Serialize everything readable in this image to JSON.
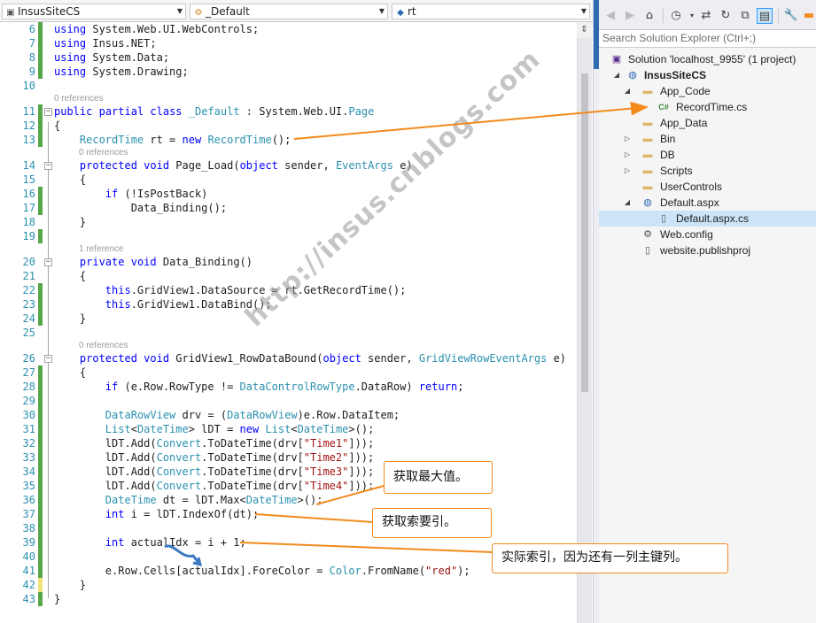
{
  "navbar": {
    "project_combo": "InsusSiteCS",
    "class_combo": "_Default",
    "member_combo": "rt"
  },
  "editor": {
    "lines": [
      {
        "n": "6",
        "seg": [
          [
            "k",
            "using"
          ],
          [
            "p",
            " System.Web.UI.WebControls;"
          ]
        ]
      },
      {
        "n": "7",
        "seg": [
          [
            "k",
            "using"
          ],
          [
            "p",
            " Insus.NET;"
          ]
        ]
      },
      {
        "n": "8",
        "seg": [
          [
            "k",
            "using"
          ],
          [
            "p",
            " System.Data;"
          ]
        ]
      },
      {
        "n": "9",
        "seg": [
          [
            "k",
            "using"
          ],
          [
            "p",
            " System.Drawing;"
          ]
        ]
      },
      {
        "n": "10",
        "seg": []
      },
      {
        "n": "11",
        "seg": [
          [
            "k",
            "public"
          ],
          [
            "p",
            " "
          ],
          [
            "k",
            "partial"
          ],
          [
            "p",
            " "
          ],
          [
            "k",
            "class"
          ],
          [
            "p",
            " "
          ],
          [
            "t",
            "_Default"
          ],
          [
            "p",
            " : System.Web.UI."
          ],
          [
            "t",
            "Page"
          ]
        ]
      },
      {
        "n": "12",
        "seg": [
          [
            "p",
            "{"
          ]
        ]
      },
      {
        "n": "13",
        "seg": [
          [
            "p",
            "    "
          ],
          [
            "t",
            "RecordTime"
          ],
          [
            "p",
            " rt = "
          ],
          [
            "k",
            "new"
          ],
          [
            "p",
            " "
          ],
          [
            "t",
            "RecordTime"
          ],
          [
            "p",
            "();"
          ]
        ]
      },
      {
        "n": "14",
        "seg": [
          [
            "p",
            "    "
          ],
          [
            "k",
            "protected"
          ],
          [
            "p",
            " "
          ],
          [
            "k",
            "void"
          ],
          [
            "p",
            " Page_Load("
          ],
          [
            "k",
            "object"
          ],
          [
            "p",
            " sender, "
          ],
          [
            "t",
            "EventArgs"
          ],
          [
            "p",
            " e)"
          ]
        ]
      },
      {
        "n": "15",
        "seg": [
          [
            "p",
            "    {"
          ]
        ]
      },
      {
        "n": "16",
        "seg": [
          [
            "p",
            "        "
          ],
          [
            "k",
            "if"
          ],
          [
            "p",
            " (!IsPostBack)"
          ]
        ]
      },
      {
        "n": "17",
        "seg": [
          [
            "p",
            "            Data_Binding();"
          ]
        ]
      },
      {
        "n": "18",
        "seg": [
          [
            "p",
            "    }"
          ]
        ]
      },
      {
        "n": "19",
        "seg": []
      },
      {
        "n": "20",
        "seg": [
          [
            "p",
            "    "
          ],
          [
            "k",
            "private"
          ],
          [
            "p",
            " "
          ],
          [
            "k",
            "void"
          ],
          [
            "p",
            " Data_Binding()"
          ]
        ]
      },
      {
        "n": "21",
        "seg": [
          [
            "p",
            "    {"
          ]
        ]
      },
      {
        "n": "22",
        "seg": [
          [
            "p",
            "        "
          ],
          [
            "k",
            "this"
          ],
          [
            "p",
            ".GridView1.DataSource = rt.GetRecordTime();"
          ]
        ]
      },
      {
        "n": "23",
        "seg": [
          [
            "p",
            "        "
          ],
          [
            "k",
            "this"
          ],
          [
            "p",
            ".GridView1.DataBind();"
          ]
        ]
      },
      {
        "n": "24",
        "seg": [
          [
            "p",
            "    }"
          ]
        ]
      },
      {
        "n": "25",
        "seg": []
      },
      {
        "n": "26",
        "seg": [
          [
            "p",
            "    "
          ],
          [
            "k",
            "protected"
          ],
          [
            "p",
            " "
          ],
          [
            "k",
            "void"
          ],
          [
            "p",
            " GridView1_RowDataBound("
          ],
          [
            "k",
            "object"
          ],
          [
            "p",
            " sender, "
          ],
          [
            "t",
            "GridViewRowEventArgs"
          ],
          [
            "p",
            " e)"
          ]
        ]
      },
      {
        "n": "27",
        "seg": [
          [
            "p",
            "    {"
          ]
        ]
      },
      {
        "n": "28",
        "seg": [
          [
            "p",
            "        "
          ],
          [
            "k",
            "if"
          ],
          [
            "p",
            " (e.Row.RowType != "
          ],
          [
            "t",
            "DataControlRowType"
          ],
          [
            "p",
            ".DataRow) "
          ],
          [
            "k",
            "return"
          ],
          [
            "p",
            ";"
          ]
        ]
      },
      {
        "n": "29",
        "seg": []
      },
      {
        "n": "30",
        "seg": [
          [
            "p",
            "        "
          ],
          [
            "t",
            "DataRowView"
          ],
          [
            "p",
            " drv = ("
          ],
          [
            "t",
            "DataRowView"
          ],
          [
            "p",
            ")e.Row.DataItem;"
          ]
        ]
      },
      {
        "n": "31",
        "seg": [
          [
            "p",
            "        "
          ],
          [
            "t",
            "List"
          ],
          [
            "p",
            "<"
          ],
          [
            "t",
            "DateTime"
          ],
          [
            "p",
            "> lDT = "
          ],
          [
            "k",
            "new"
          ],
          [
            "p",
            " "
          ],
          [
            "t",
            "List"
          ],
          [
            "p",
            "<"
          ],
          [
            "t",
            "DateTime"
          ],
          [
            "p",
            ">();"
          ]
        ]
      },
      {
        "n": "32",
        "seg": [
          [
            "p",
            "        lDT.Add("
          ],
          [
            "t",
            "Convert"
          ],
          [
            "p",
            ".ToDateTime(drv["
          ],
          [
            "s",
            "\"Time1\""
          ],
          [
            "p",
            "]));"
          ]
        ]
      },
      {
        "n": "33",
        "seg": [
          [
            "p",
            "        lDT.Add("
          ],
          [
            "t",
            "Convert"
          ],
          [
            "p",
            ".ToDateTime(drv["
          ],
          [
            "s",
            "\"Time2\""
          ],
          [
            "p",
            "]));"
          ]
        ]
      },
      {
        "n": "34",
        "seg": [
          [
            "p",
            "        lDT.Add("
          ],
          [
            "t",
            "Convert"
          ],
          [
            "p",
            ".ToDateTime(drv["
          ],
          [
            "s",
            "\"Time3\""
          ],
          [
            "p",
            "]));"
          ]
        ]
      },
      {
        "n": "35",
        "seg": [
          [
            "p",
            "        lDT.Add("
          ],
          [
            "t",
            "Convert"
          ],
          [
            "p",
            ".ToDateTime(drv["
          ],
          [
            "s",
            "\"Time4\""
          ],
          [
            "p",
            "]));"
          ]
        ]
      },
      {
        "n": "36",
        "seg": [
          [
            "p",
            "        "
          ],
          [
            "t",
            "DateTime"
          ],
          [
            "p",
            " dt = lDT.Max<"
          ],
          [
            "t",
            "DateTime"
          ],
          [
            "p",
            ">();"
          ]
        ]
      },
      {
        "n": "37",
        "seg": [
          [
            "p",
            "        "
          ],
          [
            "k",
            "int"
          ],
          [
            "p",
            " i = lDT.IndexOf(dt);"
          ]
        ]
      },
      {
        "n": "38",
        "seg": []
      },
      {
        "n": "39",
        "seg": [
          [
            "p",
            "        "
          ],
          [
            "k",
            "int"
          ],
          [
            "p",
            " actualIdx = i + 1;"
          ]
        ]
      },
      {
        "n": "40",
        "seg": []
      },
      {
        "n": "41",
        "seg": [
          [
            "p",
            "        e.Row.Cells[actualIdx].ForeColor = "
          ],
          [
            "t",
            "Color"
          ],
          [
            "p",
            ".FromName("
          ],
          [
            "s",
            "\"red\""
          ],
          [
            "p",
            ");"
          ]
        ]
      },
      {
        "n": "42",
        "seg": [
          [
            "p",
            "    }"
          ]
        ]
      },
      {
        "n": "43",
        "seg": [
          [
            "p",
            "}"
          ]
        ]
      }
    ],
    "lenses": {
      "class_refs": "0 references",
      "page_load_refs": "0 references",
      "data_binding_refs": "1 reference",
      "rowdatabound_refs": "0 references"
    }
  },
  "solution_explorer": {
    "search_placeholder": "Search Solution Explorer (Ctrl+;)",
    "items": [
      {
        "label": "Solution 'localhost_9955' (1 project)",
        "icon": "solution-icon"
      },
      {
        "label": "InsusSiteCS",
        "icon": "website-globe-icon"
      },
      {
        "label": "App_Code",
        "icon": "folder-open-icon"
      },
      {
        "label": "RecordTime.cs",
        "icon": "csharp-file-icon"
      },
      {
        "label": "App_Data",
        "icon": "folder-icon"
      },
      {
        "label": "Bin",
        "icon": "folder-icon"
      },
      {
        "label": "DB",
        "icon": "folder-icon"
      },
      {
        "label": "Scripts",
        "icon": "folder-icon"
      },
      {
        "label": "UserControls",
        "icon": "folder-icon"
      },
      {
        "label": "Default.aspx",
        "icon": "aspx-file-icon"
      },
      {
        "label": "Default.aspx.cs",
        "icon": "code-file-icon"
      },
      {
        "label": "Web.config",
        "icon": "config-file-icon"
      },
      {
        "label": "website.publishproj",
        "icon": "publish-file-icon"
      }
    ]
  },
  "annotations": {
    "max_value": "获取最大值。",
    "get_index": "获取索要引。",
    "actual_index": "实际索引，因为还有一列主键列。",
    "watermark": "http://insus.cnblogs.com"
  },
  "colors": {
    "keyword": "#0000ff",
    "type": "#2b91af",
    "string": "#a31515",
    "annotation_border": "#f28a1c",
    "selection": "#cce4f7"
  }
}
